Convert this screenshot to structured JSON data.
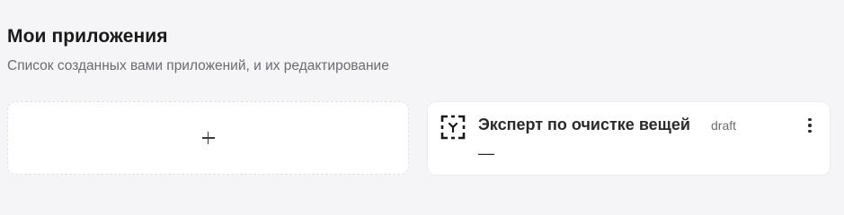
{
  "header": {
    "title": "Мои приложения",
    "subtitle": "Список созданных вами приложений, и их редактирование"
  },
  "add_card": {
    "icon": "plus-icon"
  },
  "apps": [
    {
      "name": "Эксперт по очистке вещей",
      "status": "draft",
      "description": "—",
      "icon": "app-placeholder-icon",
      "menu_icon": "more-vertical-icon"
    }
  ]
}
